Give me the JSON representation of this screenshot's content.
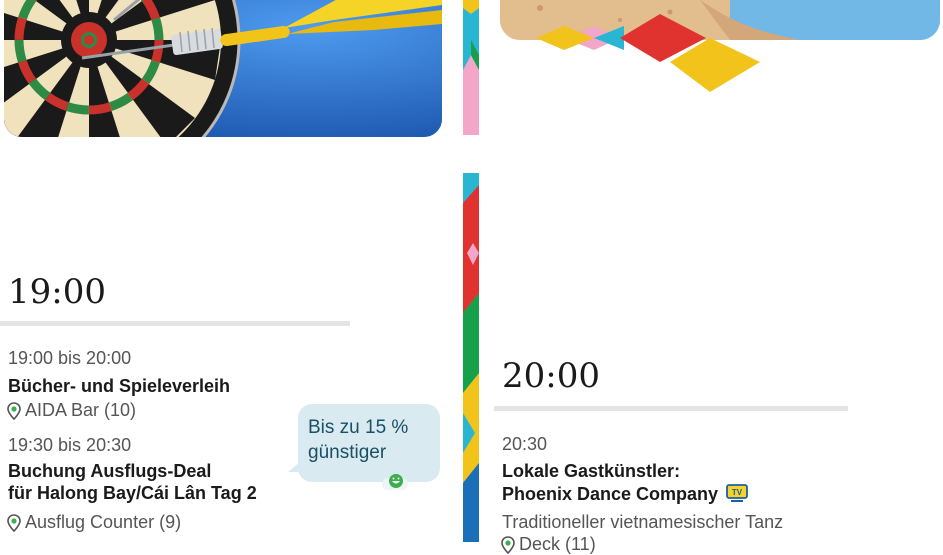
{
  "colors": {
    "accent_green": "#3cae4c",
    "bubble_bg": "#daeaf1",
    "rule_gray": "#e4e4e4",
    "stripe_cyan": "#29b6d2",
    "stripe_red": "#e0322e",
    "stripe_green": "#17a04a",
    "stripe_yellow": "#f2c31a",
    "stripe_pink": "#f2a6c9"
  },
  "left_column": {
    "heading": "19:00",
    "events": [
      {
        "time": "19:00 bis 20:00",
        "title": "Bücher- und Spieleverleih",
        "location": "AIDA Bar (10)",
        "icon": "map-pin-icon"
      },
      {
        "time": "19:30 bis 20:30",
        "title_line1": "Buchung Ausflugs-Deal",
        "title_line2": "für Halong Bay/Cái Lân Tag 2",
        "location": "Ausflug Counter (9)",
        "icon": "map-pin-icon"
      }
    ],
    "bubble": {
      "line1": "Bis zu 15 %",
      "line2": "günstiger",
      "icon": "smiley-icon"
    }
  },
  "right_column": {
    "heading": "20:00",
    "events": [
      {
        "time": "20:30",
        "title_line1": "Lokale Gastkünstler:",
        "title_line2": "Phoenix Dance Company",
        "badge_icon": "tv-icon",
        "subtitle": "Traditioneller vietnamesischer Tanz",
        "location": "Deck (11)"
      }
    ]
  }
}
